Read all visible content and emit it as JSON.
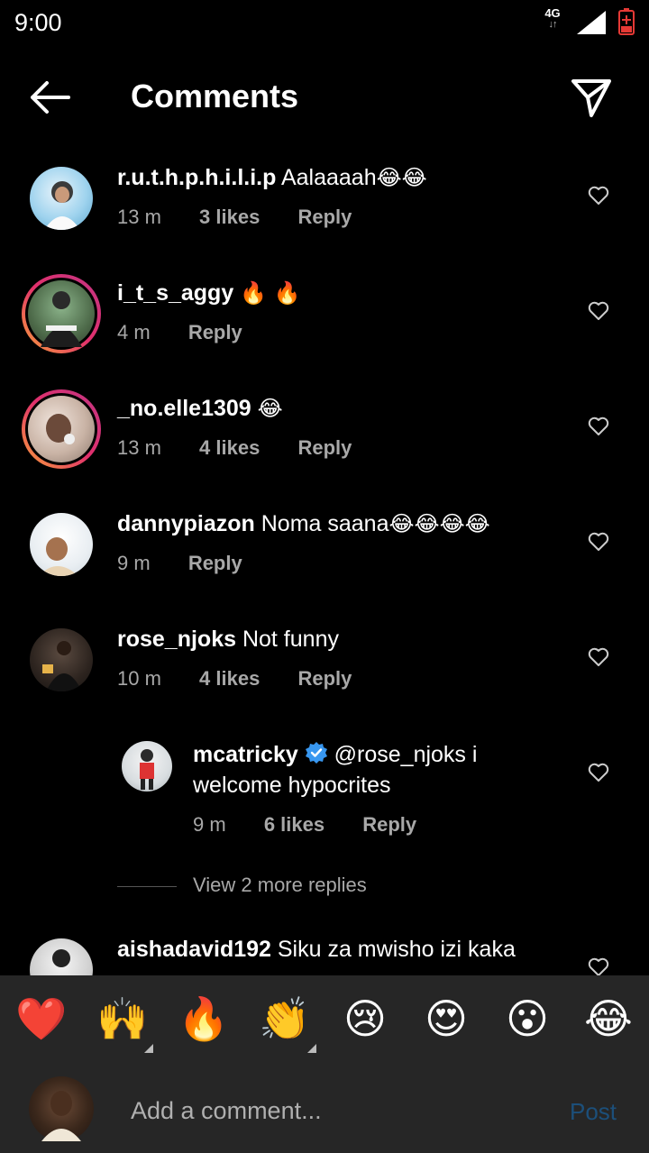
{
  "status": {
    "time": "9:00",
    "network": "4G",
    "network_arrows": "↓↑"
  },
  "header": {
    "title": "Comments"
  },
  "comments": [
    {
      "username": "r.u.t.h.p.h.i.l.i.p",
      "text": " Aalaaaah",
      "emoji": "😂😂",
      "time": "13 m",
      "likes": "3 likes",
      "reply": "Reply",
      "story_ring": false
    },
    {
      "username": "i_t_s_aggy",
      "text": " ",
      "emoji": "🔥 🔥",
      "time": "4 m",
      "likes": "",
      "reply": "Reply",
      "story_ring": true
    },
    {
      "username": "_no.elle1309",
      "text": " ",
      "emoji": "😂",
      "time": "13 m",
      "likes": "4 likes",
      "reply": "Reply",
      "story_ring": true
    },
    {
      "username": "dannypiazon",
      "text": " Noma saana",
      "emoji": "😂😂😂😂",
      "time": "9 m",
      "likes": "",
      "reply": "Reply",
      "story_ring": false
    },
    {
      "username": "rose_njoks",
      "text": " Not funny",
      "emoji": "",
      "time": "10 m",
      "likes": "4 likes",
      "reply": "Reply",
      "story_ring": false
    }
  ],
  "reply_comment": {
    "username": "mcatricky",
    "mention": "@rose_njoks",
    "text": " i welcome hypocrites",
    "time": "9 m",
    "likes": "6 likes",
    "reply": "Reply"
  },
  "view_more_replies": "View 2 more replies",
  "last_comment": {
    "username": "aishadavid192",
    "text": " Siku za mwisho izi kaka"
  },
  "emoji_tray": [
    "❤️",
    "🙌",
    "🔥",
    "👏",
    "😢",
    "😍",
    "😮",
    "😂"
  ],
  "composer": {
    "placeholder": "Add a comment...",
    "post_label": "Post"
  },
  "colors": {
    "background": "#000000",
    "tray": "#262626",
    "meta": "#a8a8a8",
    "post_disabled": "#1c4f7a",
    "verified": "#3897f0",
    "heart_red": "#ed4956"
  }
}
